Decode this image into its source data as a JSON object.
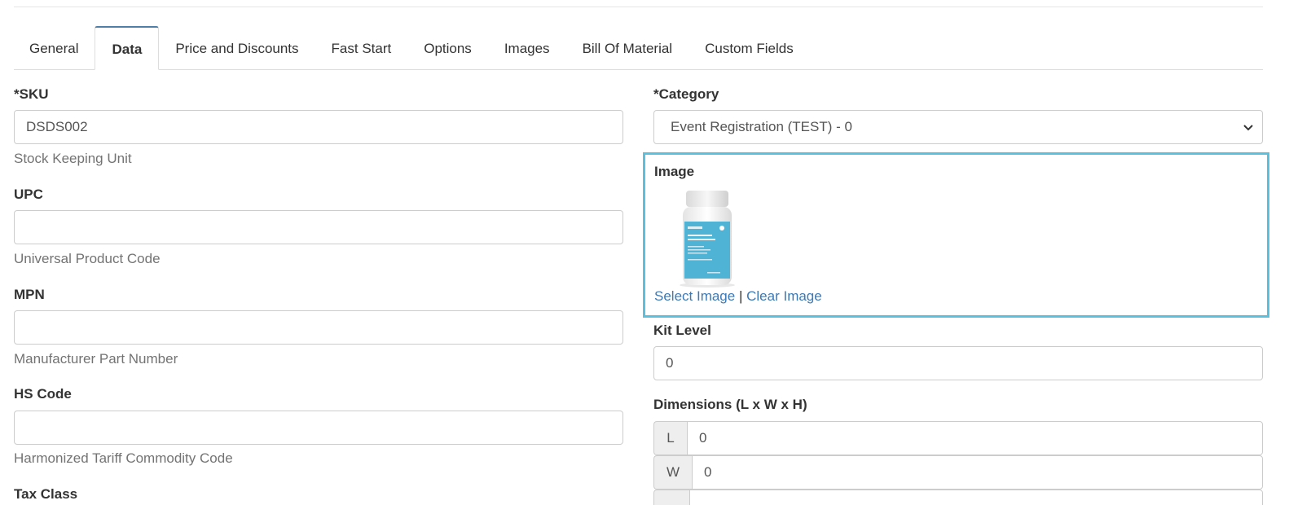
{
  "tabs": [
    {
      "label": "General"
    },
    {
      "label": "Data"
    },
    {
      "label": "Price and Discounts"
    },
    {
      "label": "Fast Start"
    },
    {
      "label": "Options"
    },
    {
      "label": "Images"
    },
    {
      "label": "Bill Of Material"
    },
    {
      "label": "Custom Fields"
    }
  ],
  "active_tab": "Data",
  "left": {
    "sku": {
      "label": "*SKU",
      "value": "DSDS002",
      "help": "Stock Keeping Unit"
    },
    "upc": {
      "label": "UPC",
      "value": "",
      "help": "Universal Product Code"
    },
    "mpn": {
      "label": "MPN",
      "value": "",
      "help": "Manufacturer Part Number"
    },
    "hs_code": {
      "label": "HS Code",
      "value": "",
      "help": "Harmonized Tariff Commodity Code"
    },
    "tax_class": {
      "label": "Tax Class"
    }
  },
  "right": {
    "category": {
      "label": "*Category",
      "value": "Event Registration (TEST) - 0"
    },
    "image": {
      "label": "Image",
      "select_link": "Select Image",
      "separator": "|",
      "clear_link": "Clear Image",
      "highlight_color": "#5bc0de"
    },
    "kit_level": {
      "label": "Kit Level",
      "value": "0"
    },
    "dimensions": {
      "label": "Dimensions (L x W x H)",
      "l": {
        "addon": "L",
        "value": "0"
      },
      "w": {
        "addon": "W",
        "value": "0"
      }
    }
  },
  "colors": {
    "link": "#3c79b7",
    "active_tab_top": "#4d7fa8",
    "border": "#cccccc"
  }
}
